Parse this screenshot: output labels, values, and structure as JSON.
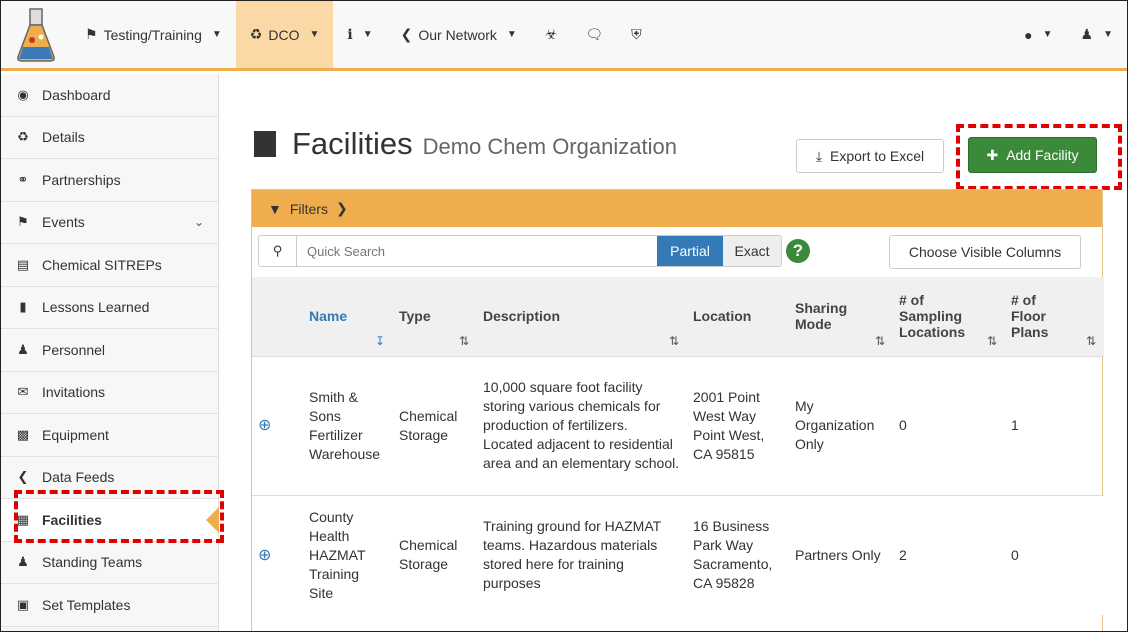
{
  "nav": {
    "testing": "Testing/Training",
    "dco": "DCO",
    "info": "i",
    "network": "Our Network"
  },
  "sidebar": {
    "items": [
      {
        "label": "Dashboard",
        "icon": "dashboard-icon"
      },
      {
        "label": "Details",
        "icon": "sitemap-icon"
      },
      {
        "label": "Partnerships",
        "icon": "partnership-icon"
      },
      {
        "label": "Events",
        "icon": "flag-icon"
      },
      {
        "label": "Chemical SITREPs",
        "icon": "report-icon"
      },
      {
        "label": "Lessons Learned",
        "icon": "book-icon"
      },
      {
        "label": "Personnel",
        "icon": "user-icon"
      },
      {
        "label": "Invitations",
        "icon": "envelope-icon"
      },
      {
        "label": "Equipment",
        "icon": "equipment-icon"
      },
      {
        "label": "Data Feeds",
        "icon": "share-icon"
      },
      {
        "label": "Facilities",
        "icon": "building-icon"
      },
      {
        "label": "Standing Teams",
        "icon": "users-icon"
      },
      {
        "label": "Set Templates",
        "icon": "template-icon"
      }
    ]
  },
  "page": {
    "title": "Facilities",
    "subtitle": "Demo Chem Organization",
    "export_label": "Export to Excel",
    "add_label": "Add Facility"
  },
  "filters": {
    "label": "Filters"
  },
  "search": {
    "placeholder": "Quick Search",
    "partial": "Partial",
    "exact": "Exact",
    "help": "?",
    "columns_button": "Choose Visible Columns"
  },
  "table": {
    "headers": {
      "name": "Name",
      "type": "Type",
      "description": "Description",
      "location": "Location",
      "sharing": "Sharing Mode",
      "sampling": "# of Sampling Locations",
      "floor": "# of Floor Plans"
    },
    "rows": [
      {
        "name": "Smith & Sons Fertilizer Warehouse",
        "type": "Chemical Storage",
        "description": "10,000 square foot facility storing various chemicals for production of fertilizers. Located adjacent to residential area and an elementary school.",
        "location": "2001 Point West Way Point West, CA 95815",
        "sharing": "My Organization Only",
        "sampling": "0",
        "floor": "1"
      },
      {
        "name": "County Health HAZMAT Training Site",
        "type": "Chemical Storage",
        "description": "Training ground for HAZMAT teams. Hazardous materials stored here for training purposes",
        "location": "16 Business Park Way Sacramento, CA 95828",
        "sharing": "Partners Only",
        "sampling": "2",
        "floor": "0"
      }
    ]
  },
  "colors": {
    "accent": "#f0ad4e",
    "primary": "#337ab7",
    "success": "#3a8a3a",
    "highlight": "#e00000"
  }
}
